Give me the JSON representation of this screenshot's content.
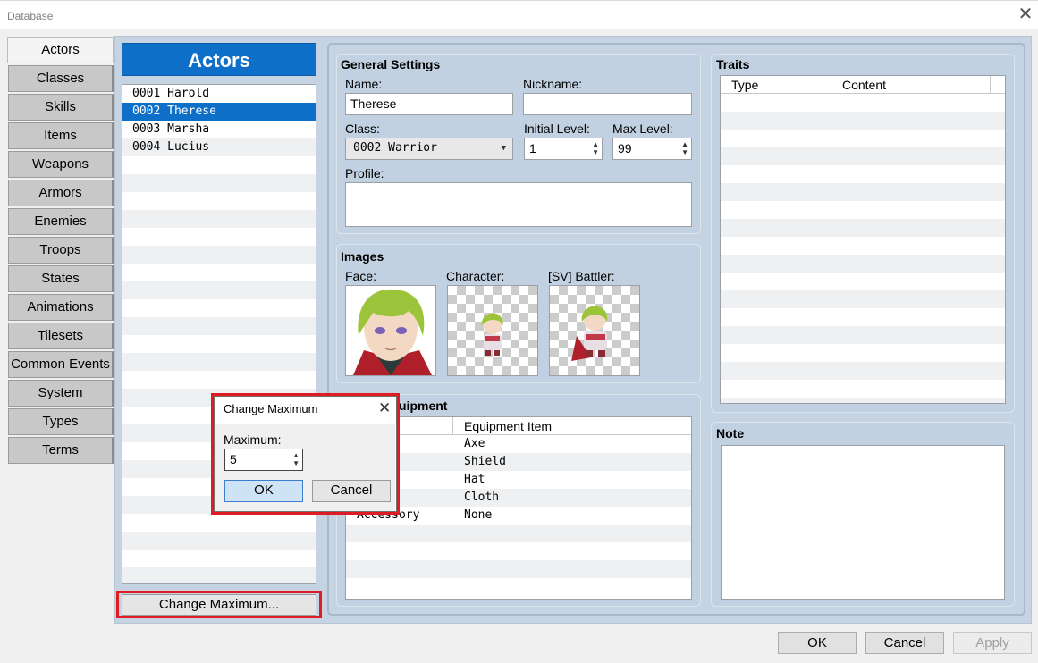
{
  "window": {
    "title": "Database",
    "close": "✕"
  },
  "tabs": [
    {
      "label": "Actors",
      "active": true
    },
    {
      "label": "Classes"
    },
    {
      "label": "Skills"
    },
    {
      "label": "Items"
    },
    {
      "label": "Weapons"
    },
    {
      "label": "Armors"
    },
    {
      "label": "Enemies"
    },
    {
      "label": "Troops"
    },
    {
      "label": "States"
    },
    {
      "label": "Animations"
    },
    {
      "label": "Tilesets"
    },
    {
      "label": "Common Events"
    },
    {
      "label": "System"
    },
    {
      "label": "Types"
    },
    {
      "label": "Terms"
    }
  ],
  "list": {
    "header": "Actors",
    "items": [
      "0001 Harold",
      "0002 Therese",
      "0003 Marsha",
      "0004 Lucius"
    ],
    "selected": 1,
    "change_max_label": "Change Maximum..."
  },
  "general": {
    "title": "General Settings",
    "name_label": "Name:",
    "name_value": "Therese",
    "nickname_label": "Nickname:",
    "nickname_value": "",
    "class_label": "Class:",
    "class_value": "0002 Warrior",
    "initial_level_label": "Initial Level:",
    "initial_level_value": "1",
    "max_level_label": "Max Level:",
    "max_level_value": "99",
    "profile_label": "Profile:",
    "profile_value": ""
  },
  "images": {
    "title": "Images",
    "face_label": "Face:",
    "character_label": "Character:",
    "battler_label": "[SV] Battler:"
  },
  "equipment": {
    "title": "uipment",
    "col_item": "Equipment Item",
    "rows": [
      {
        "type": "",
        "item": "Axe"
      },
      {
        "type": "",
        "item": "Shield"
      },
      {
        "type": "",
        "item": "Hat"
      },
      {
        "type": "",
        "item": "Cloth"
      },
      {
        "type": "Accessory",
        "item": "None"
      }
    ]
  },
  "traits": {
    "title": "Traits",
    "col_type": "Type",
    "col_content": "Content"
  },
  "note": {
    "title": "Note"
  },
  "dialog": {
    "title": "Change Maximum",
    "close": "✕",
    "max_label": "Maximum:",
    "max_value": "5",
    "ok": "OK",
    "cancel": "Cancel"
  },
  "buttons": {
    "ok": "OK",
    "cancel": "Cancel",
    "apply": "Apply"
  },
  "colors": {
    "accent": "#0d6fc8",
    "highlight": "#e01b24",
    "panel": "#c5d3e2"
  }
}
